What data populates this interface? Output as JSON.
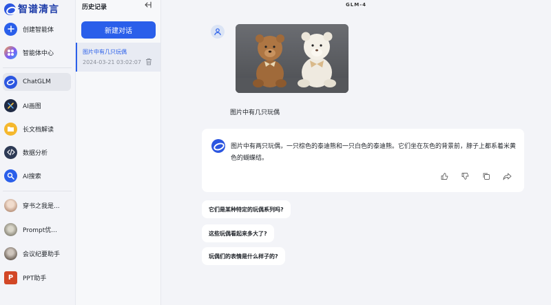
{
  "logo": {
    "text": "智谱清言"
  },
  "sidebar": {
    "items": [
      {
        "label": "创建智能体",
        "icon": "plus-icon",
        "color": "#2a5fea"
      },
      {
        "label": "智能体中心",
        "icon": "grid-icon",
        "color": "#7c5cf5"
      },
      {
        "label": "ChatGLM",
        "icon": "chatglm-icon",
        "color": "#2c56e0"
      },
      {
        "label": "AI画图",
        "icon": "brush-icon",
        "color": "#1f2a44"
      },
      {
        "label": "长文档解读",
        "icon": "folder-icon",
        "color": "#f5b82e"
      },
      {
        "label": "数据分析",
        "icon": "code-icon",
        "color": "#2d3a55"
      },
      {
        "label": "AI搜索",
        "icon": "search-icon",
        "color": "#2a5fea"
      },
      {
        "label": "穿书之我是...",
        "icon": "avatar-icon",
        "color": "#c9a892"
      },
      {
        "label": "Prompt优...",
        "icon": "avatar-icon",
        "color": "#8a8f80"
      },
      {
        "label": "会议纪要助手",
        "icon": "avatar-icon",
        "color": "#7a6a5e"
      },
      {
        "label": "PPT助手",
        "icon": "ppt-icon",
        "color": "#d24726"
      }
    ]
  },
  "history": {
    "title": "历史记录",
    "new_chat_label": "新建对话",
    "items": [
      {
        "title": "图片中有几只玩偶",
        "time": "2024-03-21 03:02:07"
      }
    ]
  },
  "main": {
    "model_title": "GLM-4",
    "user_message": "图片中有几只玩偶",
    "answer": "图片中有两只玩偶，一只棕色的泰迪熊和一只白色的泰迪熊。它们坐在灰色的背景前，脖子上都系着米黄色的蝴蝶结。",
    "suggestions": [
      "它们是某种特定的玩偶系列吗?",
      "这些玩偶看起来多大了?",
      "玩偶们的表情是什么样子的?"
    ]
  },
  "colors": {
    "accent": "#2a5fea",
    "background": "#f3f4f8"
  }
}
